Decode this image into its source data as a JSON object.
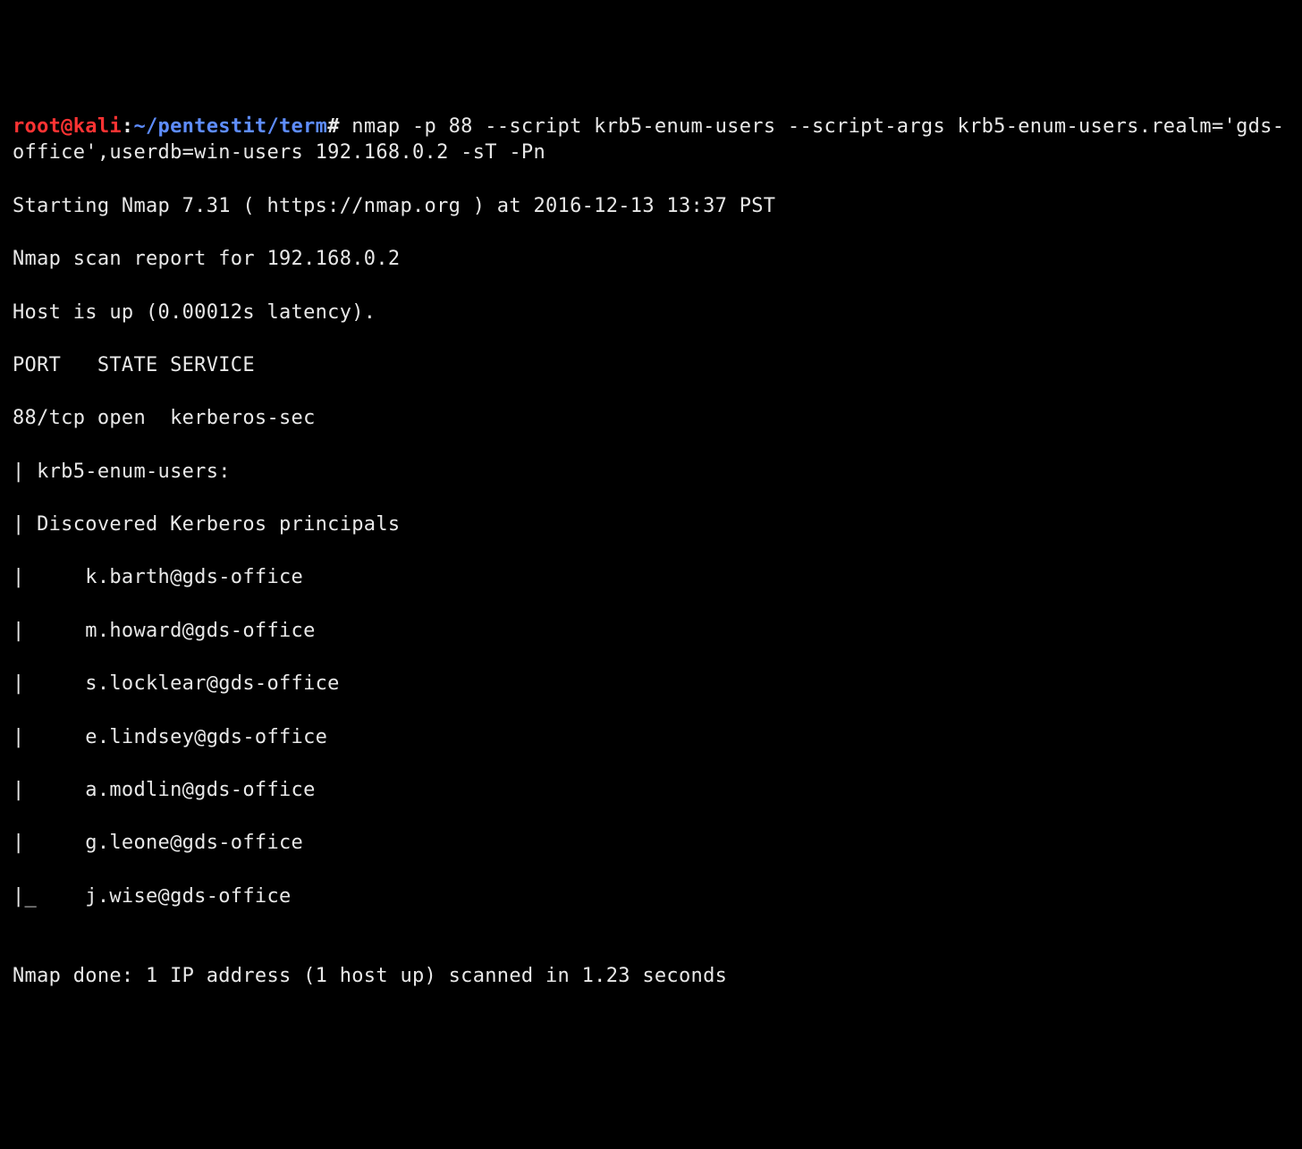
{
  "prompt": {
    "user": "root@kali",
    "separator": ":",
    "path": "~/pentestit/term",
    "hash": "#"
  },
  "command": " nmap -p 88 --script krb5-enum-users --script-args krb5-enum-users.realm='gds-office',userdb=win-users 192.168.0.2 -sT -Pn",
  "blank1": "",
  "out01": "Starting Nmap 7.31 ( https://nmap.org ) at 2016-12-13 13:37 PST",
  "out02": "Nmap scan report for 192.168.0.2",
  "out03": "Host is up (0.00012s latency).",
  "out04": "PORT   STATE SERVICE",
  "out05": "88/tcp open  kerberos-sec",
  "out06": "| krb5-enum-users:",
  "out07": "| Discovered Kerberos principals",
  "out08": "|     k.barth@gds-office",
  "out09": "|     m.howard@gds-office",
  "out10": "|     s.locklear@gds-office",
  "out11": "|     e.lindsey@gds-office",
  "out12": "|     a.modlin@gds-office",
  "out13": "|     g.leone@gds-office",
  "out14": "|_    j.wise@gds-office",
  "blank2": "",
  "out15": "Nmap done: 1 IP address (1 host up) scanned in 1.23 seconds"
}
